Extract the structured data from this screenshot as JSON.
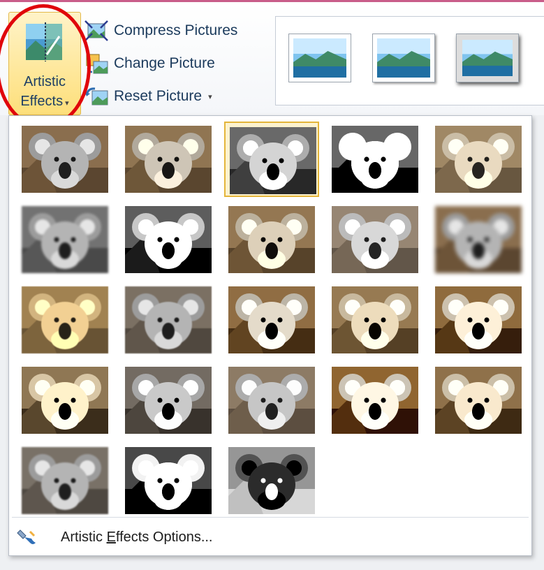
{
  "ribbon": {
    "artistic_effects": {
      "line1": "Artistic",
      "line2": "Effects",
      "caret": "▾",
      "icon": "artistic-effects-icon"
    },
    "commands": [
      {
        "label": "Compress Pictures",
        "icon": "compress-pictures-icon"
      },
      {
        "label": "Change Picture",
        "icon": "change-picture-icon"
      },
      {
        "label": "Reset Picture",
        "caret": "▾",
        "icon": "reset-picture-icon"
      }
    ],
    "picture_styles_visible": 3
  },
  "gallery": {
    "rows": 5,
    "columns": 5,
    "effect_count": 23,
    "selected_index": 2
  },
  "footer": {
    "options_prefix": "Artistic ",
    "options_underlined": "E",
    "options_suffix": "ffects Options...",
    "icon": "paint-brush-icon"
  },
  "colors": {
    "highlight_circle": "#e0050b",
    "selected_border": "#e4b53a",
    "button_gradient_top": "#fff3c8",
    "button_gradient_bottom": "#fddf7a",
    "ribbon_text": "#1b3a5c"
  }
}
